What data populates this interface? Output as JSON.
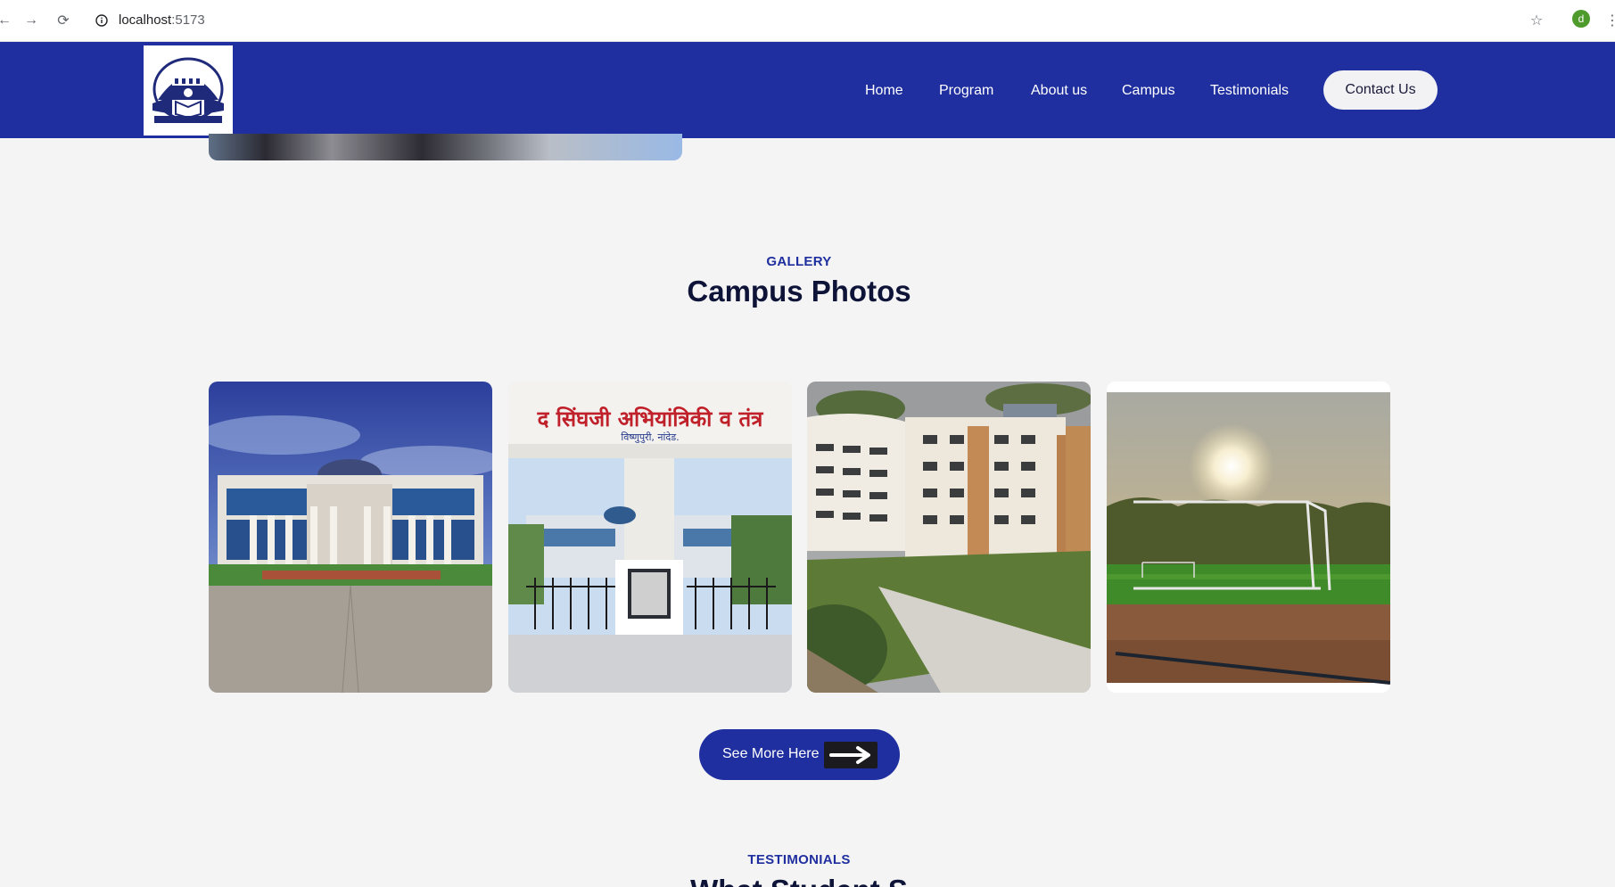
{
  "browser": {
    "url_host": "localhost",
    "url_port": ":5173",
    "profile_initial": "d"
  },
  "nav": {
    "links": [
      "Home",
      "Program",
      "About us",
      "Campus",
      "Testimonials"
    ],
    "contact_label": "Contact Us",
    "logo_icon": "college-emblem-icon",
    "background_color": "#1f2f9f"
  },
  "gallery": {
    "eyebrow": "GALLERY",
    "title": "Campus Photos",
    "photos": [
      {
        "name": "main-building-photo",
        "gate_text": ""
      },
      {
        "name": "entrance-gate-photo",
        "gate_text": "द सिंघजी अभियांत्रिकी व तंत्र",
        "gate_subtext": "विष्णुपुरी, नांदेड."
      },
      {
        "name": "hostel-building-photo",
        "gate_text": ""
      },
      {
        "name": "sports-ground-photo",
        "gate_text": ""
      }
    ],
    "see_more_label": "See More Here",
    "see_more_icon": "arrow-right-icon"
  },
  "testimonials": {
    "eyebrow": "TESTIMONIALS",
    "title": "What Student S"
  },
  "colors": {
    "accent": "#1f2f9f",
    "heading": "#0e1338",
    "page_bg": "#f4f4f4"
  }
}
